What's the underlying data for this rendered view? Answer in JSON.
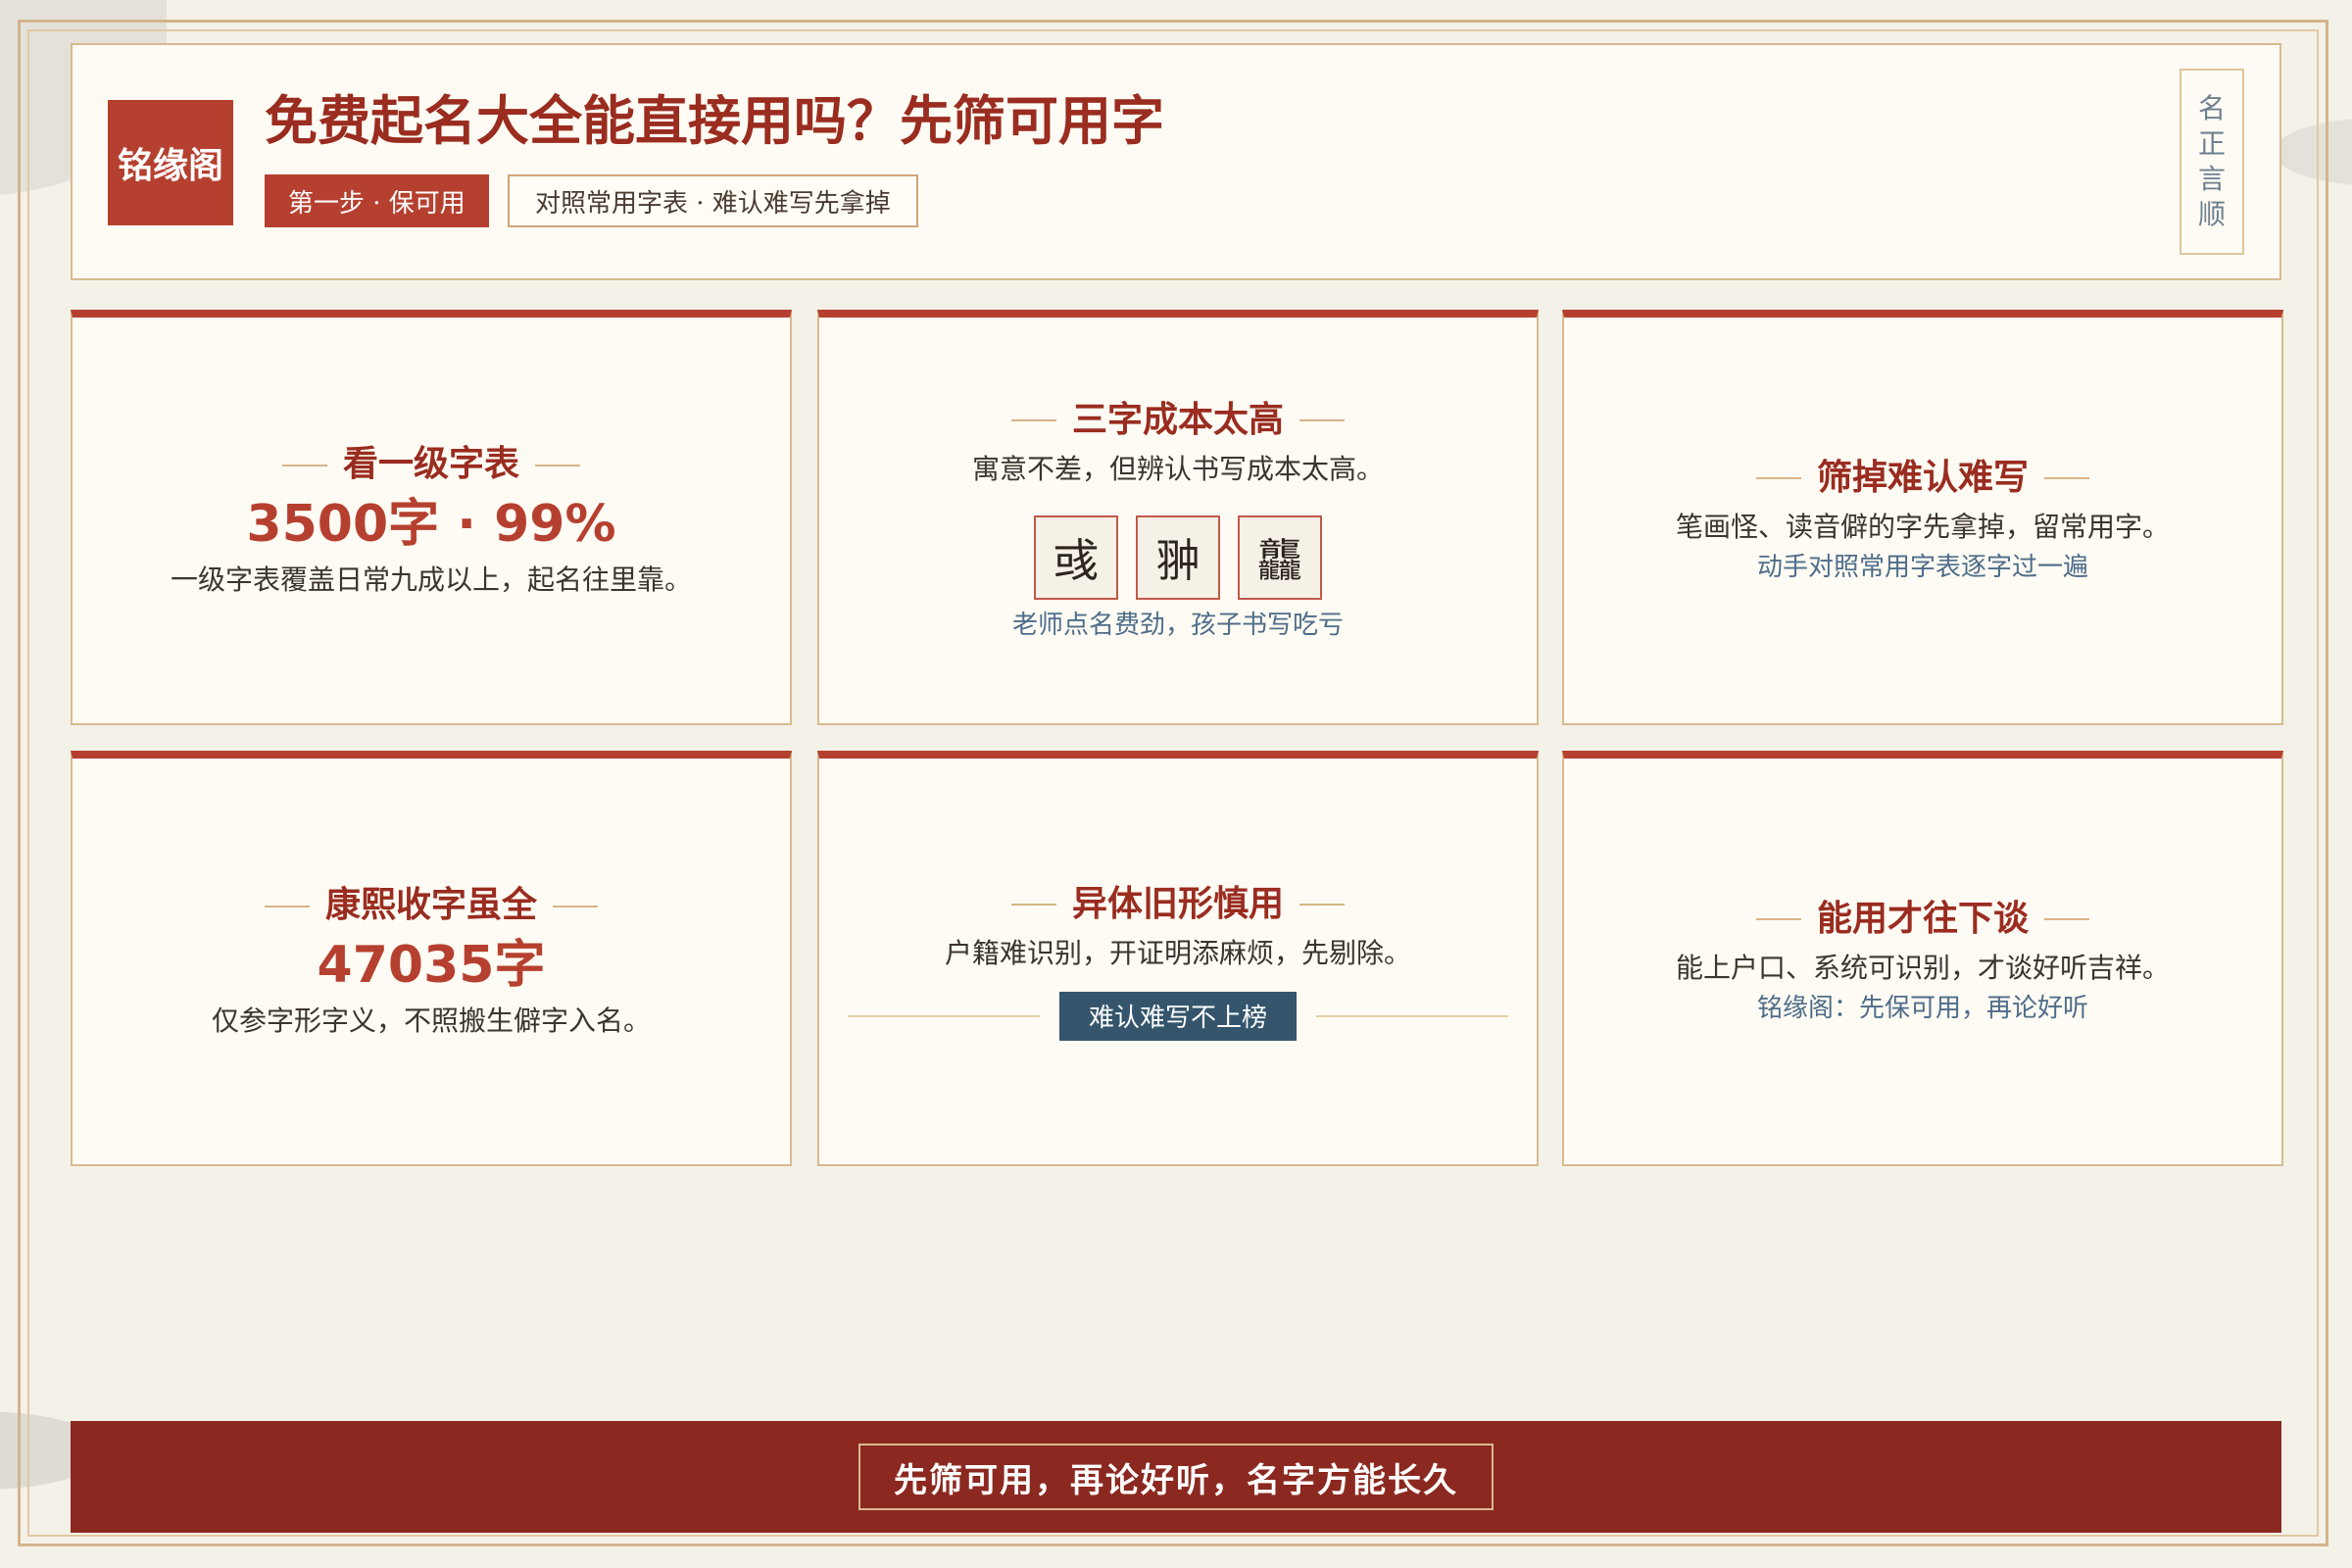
{
  "header": {
    "logo": "铭缘阁",
    "title": "免费起名大全能直接用吗？先筛可用字",
    "step_tag": "第一步 · 保可用",
    "desc_tag": "对照常用字表 · 难认难写先拿掉",
    "seal_chars": [
      "名",
      "正",
      "言",
      "顺"
    ]
  },
  "cards": [
    {
      "title": "看一级字表",
      "stat": "3500字 · 99%",
      "desc": "一级字表覆盖日常九成以上，起名往里靠。"
    },
    {
      "title": "三字成本太高",
      "desc": "寓意不差，但辨认书写成本太高。",
      "example_chars": [
        "彧",
        "翀",
        "龘"
      ],
      "note": "老师点名费劲，孩子书写吃亏"
    },
    {
      "title": "筛掉难认难写",
      "desc": "笔画怪、读音僻的字先拿掉，留常用字。",
      "note": "动手对照常用字表逐字过一遍"
    },
    {
      "title": "康熙收字虽全",
      "stat": "47035字",
      "desc": "仅参字形字义，不照搬生僻字入名。"
    },
    {
      "title": "异体旧形慎用",
      "desc": "户籍难识别，开证明添麻烦，先剔除。",
      "badge": "难认难写不上榜"
    },
    {
      "title": "能用才往下谈",
      "desc": "能上户口、系统可识别，才谈好听吉祥。",
      "note": "铭缘阁：先保可用，再论好听"
    }
  ],
  "footer": {
    "slogan": "先筛可用，再论好听，名字方能长久"
  },
  "colors": {
    "brand_red": "#b6402f",
    "dark_red": "#8b2920",
    "title_red": "#9a2c20",
    "accent_blue": "#34556c",
    "gold_border": "#d8ba90",
    "paper": "#fdfbf3"
  }
}
